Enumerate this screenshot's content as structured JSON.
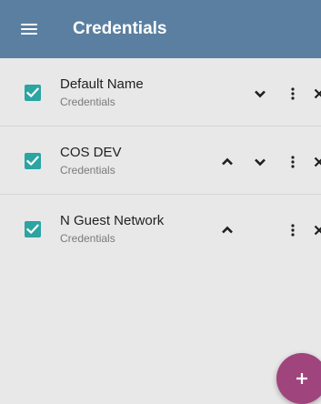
{
  "appbar": {
    "title": "Credentials",
    "menu_icon": "hamburger-menu-icon",
    "color": "#5b7fa1"
  },
  "credentials": [
    {
      "name": "Default Name",
      "subtitle": "Credentials",
      "checked": true,
      "show_up": false,
      "show_down": true
    },
    {
      "name": "COS DEV",
      "subtitle": "Credentials",
      "checked": true,
      "show_up": true,
      "show_down": true
    },
    {
      "name": "N Guest Network",
      "subtitle": "Credentials",
      "checked": true,
      "show_up": true,
      "show_down": false
    }
  ],
  "icons": {
    "up": "chevron-up-icon",
    "down": "chevron-down-icon",
    "more": "more-vertical-icon",
    "close": "close-icon",
    "add": "plus-icon"
  },
  "colors": {
    "checkbox": "#2ba4a2",
    "fab": "#a0447e",
    "background": "#e8e8e8"
  }
}
